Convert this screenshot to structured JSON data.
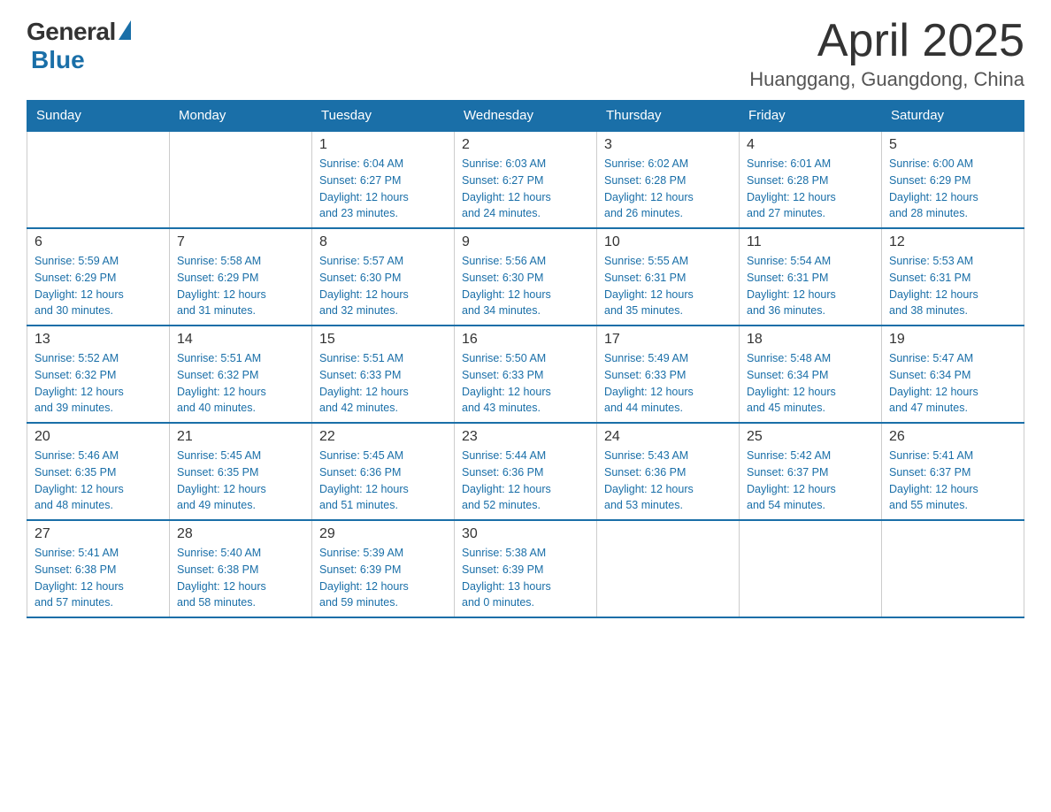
{
  "header": {
    "logo_general": "General",
    "logo_blue": "Blue",
    "title": "April 2025",
    "location": "Huanggang, Guangdong, China"
  },
  "weekdays": [
    "Sunday",
    "Monday",
    "Tuesday",
    "Wednesday",
    "Thursday",
    "Friday",
    "Saturday"
  ],
  "weeks": [
    [
      {
        "day": "",
        "info": ""
      },
      {
        "day": "",
        "info": ""
      },
      {
        "day": "1",
        "info": "Sunrise: 6:04 AM\nSunset: 6:27 PM\nDaylight: 12 hours\nand 23 minutes."
      },
      {
        "day": "2",
        "info": "Sunrise: 6:03 AM\nSunset: 6:27 PM\nDaylight: 12 hours\nand 24 minutes."
      },
      {
        "day": "3",
        "info": "Sunrise: 6:02 AM\nSunset: 6:28 PM\nDaylight: 12 hours\nand 26 minutes."
      },
      {
        "day": "4",
        "info": "Sunrise: 6:01 AM\nSunset: 6:28 PM\nDaylight: 12 hours\nand 27 minutes."
      },
      {
        "day": "5",
        "info": "Sunrise: 6:00 AM\nSunset: 6:29 PM\nDaylight: 12 hours\nand 28 minutes."
      }
    ],
    [
      {
        "day": "6",
        "info": "Sunrise: 5:59 AM\nSunset: 6:29 PM\nDaylight: 12 hours\nand 30 minutes."
      },
      {
        "day": "7",
        "info": "Sunrise: 5:58 AM\nSunset: 6:29 PM\nDaylight: 12 hours\nand 31 minutes."
      },
      {
        "day": "8",
        "info": "Sunrise: 5:57 AM\nSunset: 6:30 PM\nDaylight: 12 hours\nand 32 minutes."
      },
      {
        "day": "9",
        "info": "Sunrise: 5:56 AM\nSunset: 6:30 PM\nDaylight: 12 hours\nand 34 minutes."
      },
      {
        "day": "10",
        "info": "Sunrise: 5:55 AM\nSunset: 6:31 PM\nDaylight: 12 hours\nand 35 minutes."
      },
      {
        "day": "11",
        "info": "Sunrise: 5:54 AM\nSunset: 6:31 PM\nDaylight: 12 hours\nand 36 minutes."
      },
      {
        "day": "12",
        "info": "Sunrise: 5:53 AM\nSunset: 6:31 PM\nDaylight: 12 hours\nand 38 minutes."
      }
    ],
    [
      {
        "day": "13",
        "info": "Sunrise: 5:52 AM\nSunset: 6:32 PM\nDaylight: 12 hours\nand 39 minutes."
      },
      {
        "day": "14",
        "info": "Sunrise: 5:51 AM\nSunset: 6:32 PM\nDaylight: 12 hours\nand 40 minutes."
      },
      {
        "day": "15",
        "info": "Sunrise: 5:51 AM\nSunset: 6:33 PM\nDaylight: 12 hours\nand 42 minutes."
      },
      {
        "day": "16",
        "info": "Sunrise: 5:50 AM\nSunset: 6:33 PM\nDaylight: 12 hours\nand 43 minutes."
      },
      {
        "day": "17",
        "info": "Sunrise: 5:49 AM\nSunset: 6:33 PM\nDaylight: 12 hours\nand 44 minutes."
      },
      {
        "day": "18",
        "info": "Sunrise: 5:48 AM\nSunset: 6:34 PM\nDaylight: 12 hours\nand 45 minutes."
      },
      {
        "day": "19",
        "info": "Sunrise: 5:47 AM\nSunset: 6:34 PM\nDaylight: 12 hours\nand 47 minutes."
      }
    ],
    [
      {
        "day": "20",
        "info": "Sunrise: 5:46 AM\nSunset: 6:35 PM\nDaylight: 12 hours\nand 48 minutes."
      },
      {
        "day": "21",
        "info": "Sunrise: 5:45 AM\nSunset: 6:35 PM\nDaylight: 12 hours\nand 49 minutes."
      },
      {
        "day": "22",
        "info": "Sunrise: 5:45 AM\nSunset: 6:36 PM\nDaylight: 12 hours\nand 51 minutes."
      },
      {
        "day": "23",
        "info": "Sunrise: 5:44 AM\nSunset: 6:36 PM\nDaylight: 12 hours\nand 52 minutes."
      },
      {
        "day": "24",
        "info": "Sunrise: 5:43 AM\nSunset: 6:36 PM\nDaylight: 12 hours\nand 53 minutes."
      },
      {
        "day": "25",
        "info": "Sunrise: 5:42 AM\nSunset: 6:37 PM\nDaylight: 12 hours\nand 54 minutes."
      },
      {
        "day": "26",
        "info": "Sunrise: 5:41 AM\nSunset: 6:37 PM\nDaylight: 12 hours\nand 55 minutes."
      }
    ],
    [
      {
        "day": "27",
        "info": "Sunrise: 5:41 AM\nSunset: 6:38 PM\nDaylight: 12 hours\nand 57 minutes."
      },
      {
        "day": "28",
        "info": "Sunrise: 5:40 AM\nSunset: 6:38 PM\nDaylight: 12 hours\nand 58 minutes."
      },
      {
        "day": "29",
        "info": "Sunrise: 5:39 AM\nSunset: 6:39 PM\nDaylight: 12 hours\nand 59 minutes."
      },
      {
        "day": "30",
        "info": "Sunrise: 5:38 AM\nSunset: 6:39 PM\nDaylight: 13 hours\nand 0 minutes."
      },
      {
        "day": "",
        "info": ""
      },
      {
        "day": "",
        "info": ""
      },
      {
        "day": "",
        "info": ""
      }
    ]
  ]
}
